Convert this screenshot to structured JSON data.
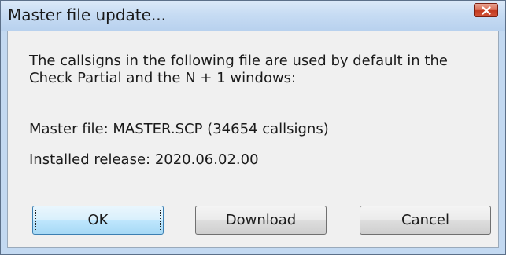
{
  "window": {
    "title": "Master file update..."
  },
  "message": {
    "line1": "The callsigns in the following file are used by default in the",
    "line2": "Check Partial and the N + 1 windows:"
  },
  "master_file": "Master file: MASTER.SCP (34654 callsigns)",
  "installed_release": "Installed release: 2020.06.02.00",
  "buttons": {
    "ok": "OK",
    "download": "Download",
    "cancel": "Cancel"
  },
  "icons": {
    "close": "close-x-icon"
  },
  "colors": {
    "titlebar": "#c7dcf3",
    "close_button": "#c9452c",
    "client_bg": "#f0f0f0",
    "default_button_border": "#3c7fb1"
  }
}
